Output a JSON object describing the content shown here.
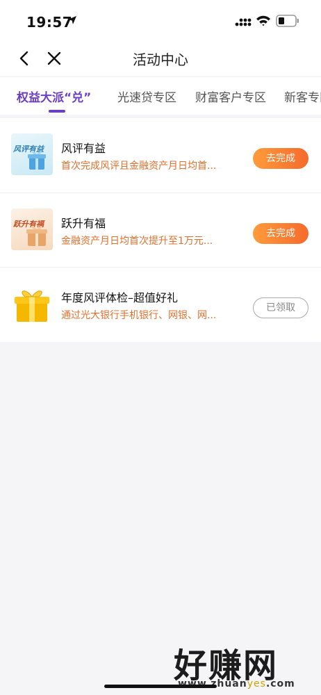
{
  "status_bar": {
    "time": "19:57"
  },
  "nav": {
    "title": "活动中心"
  },
  "tabs": [
    {
      "label": "权益大派“兑”",
      "active": true
    },
    {
      "label": "光速贷专区"
    },
    {
      "label": "财富客户专区"
    },
    {
      "label": "新客专区"
    }
  ],
  "items": [
    {
      "thumb_text": "风评有益",
      "title": "风评有益",
      "desc": "首次完成风评且金融资产月日均首...",
      "button": "去完成",
      "button_state": "active"
    },
    {
      "thumb_text": "跃升有福",
      "title": "跃升有福",
      "desc": "金融资产月日均首次提升至1万元...",
      "button": "去完成",
      "button_state": "active"
    },
    {
      "thumb_text": "",
      "title": "年度风评体检–超值好礼",
      "desc": "通过光大银行手机银行、网银、网...",
      "button": "已领取",
      "button_state": "disabled"
    }
  ],
  "watermark": {
    "text": "好赚网",
    "url_pre": "www.zhuan",
    "url_mid": "yes",
    "url_post": ".com"
  },
  "colors": {
    "accent": "#6b3fc4",
    "orange": "#f56a2b",
    "desc": "#e0702e"
  }
}
